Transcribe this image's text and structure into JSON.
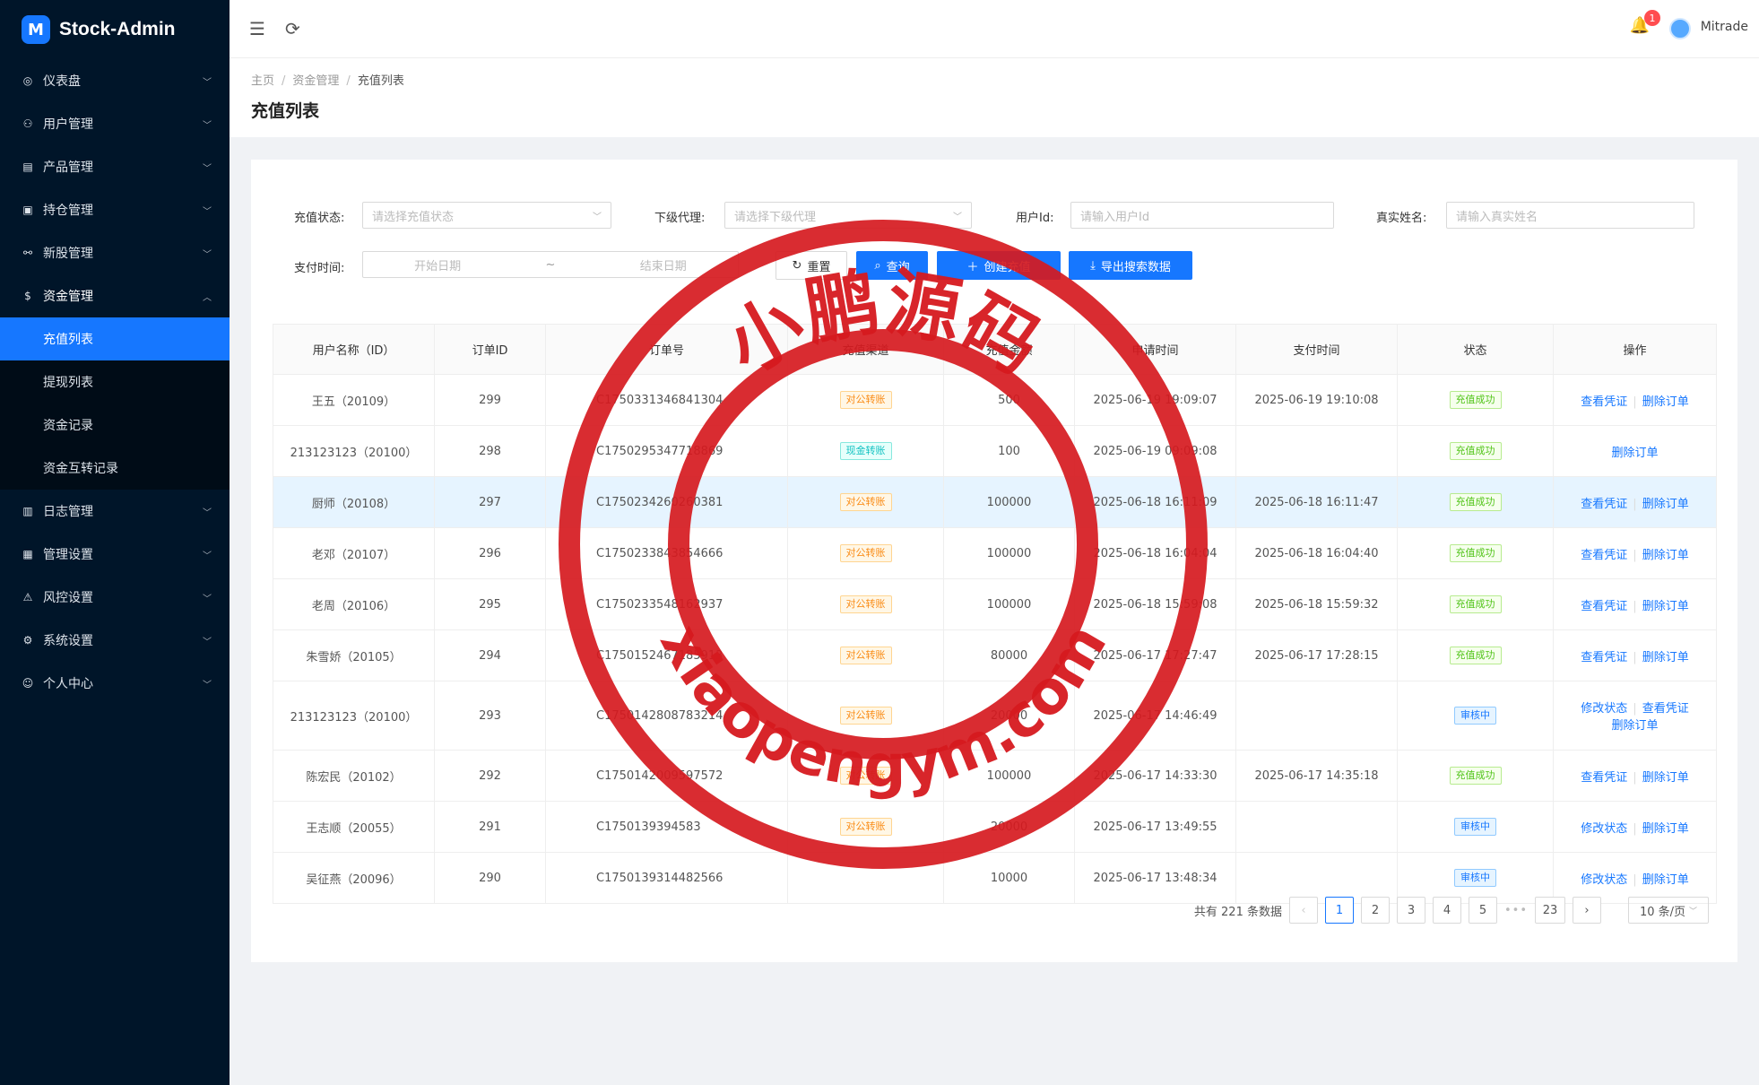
{
  "app": {
    "title": "Stock-Admin",
    "logo_glyph": "M"
  },
  "sidebar": {
    "items": [
      {
        "label": "仪表盘",
        "icon": "dashboard-icon"
      },
      {
        "label": "用户管理",
        "icon": "users-icon"
      },
      {
        "label": "产品管理",
        "icon": "chart-icon"
      },
      {
        "label": "持仓管理",
        "icon": "position-icon"
      },
      {
        "label": "新股管理",
        "icon": "ipo-icon"
      },
      {
        "label": "资金管理",
        "icon": "dollar-icon"
      },
      {
        "label": "日志管理",
        "icon": "log-icon"
      },
      {
        "label": "管理设置",
        "icon": "admin-icon"
      },
      {
        "label": "风控设置",
        "icon": "warning-icon"
      },
      {
        "label": "系统设置",
        "icon": "gear-icon"
      },
      {
        "label": "个人中心",
        "icon": "user-icon"
      }
    ],
    "submenu": [
      "充值列表",
      "提现列表",
      "资金记录",
      "资金互转记录"
    ]
  },
  "header": {
    "notification_count": "1",
    "username": "Mitrade"
  },
  "breadcrumb": {
    "home": "主页",
    "section": "资金管理",
    "current": "充值列表"
  },
  "page": {
    "title": "充值列表"
  },
  "filters": {
    "status_label": "充值状态:",
    "status_placeholder": "请选择充值状态",
    "agent_label": "下级代理:",
    "agent_placeholder": "请选择下级代理",
    "userid_label": "用户Id:",
    "userid_placeholder": "请输入用户Id",
    "realname_label": "真实姓名:",
    "realname_placeholder": "请输入真实姓名",
    "paytime_label": "支付时间:",
    "start_placeholder": "开始日期",
    "range_sep": "~",
    "end_placeholder": "结束日期",
    "reset_label": "重置",
    "query_label": "查询",
    "create_label": "创建充值",
    "export_label": "导出搜索数据"
  },
  "table": {
    "columns": [
      "用户名称（ID）",
      "订单ID",
      "订单号",
      "充值渠道",
      "充值金额",
      "申请时间",
      "支付时间",
      "状态",
      "操作"
    ],
    "rows": [
      {
        "user": "王五（20109）",
        "id": "299",
        "order": "C1750331346841304",
        "channel": "对公转账",
        "ch": "orange",
        "amount": "500",
        "apply": "2025-06-19 19:09:07",
        "pay": "2025-06-19 19:10:08",
        "status": "充值成功",
        "st": "green",
        "ops": [
          "查看凭证",
          "删除订单"
        ]
      },
      {
        "user": "213123123（20100）",
        "id": "298",
        "order": "C1750295347718869",
        "channel": "现金转账",
        "ch": "cyan",
        "amount": "100",
        "apply": "2025-06-19 09:09:08",
        "pay": "",
        "status": "充值成功",
        "st": "green",
        "ops": [
          "删除订单"
        ]
      },
      {
        "user": "厨师（20108）",
        "id": "297",
        "order": "C1750234260260381",
        "channel": "对公转账",
        "ch": "orange",
        "amount": "100000",
        "apply": "2025-06-18 16:11:09",
        "pay": "2025-06-18 16:11:47",
        "status": "充值成功",
        "st": "green",
        "ops": [
          "查看凭证",
          "删除订单"
        ]
      },
      {
        "user": "老邓（20107）",
        "id": "296",
        "order": "C1750233843854666",
        "channel": "对公转账",
        "ch": "orange",
        "amount": "100000",
        "apply": "2025-06-18 16:04:04",
        "pay": "2025-06-18 16:04:40",
        "status": "充值成功",
        "st": "green",
        "ops": [
          "查看凭证",
          "删除订单"
        ]
      },
      {
        "user": "老周（20106）",
        "id": "295",
        "order": "C1750233548162937",
        "channel": "对公转账",
        "ch": "orange",
        "amount": "100000",
        "apply": "2025-06-18 15:59:08",
        "pay": "2025-06-18 15:59:32",
        "status": "充值成功",
        "st": "green",
        "ops": [
          "查看凭证",
          "删除订单"
        ]
      },
      {
        "user": "朱雪娇（20105）",
        "id": "294",
        "order": "C1750152467185913",
        "channel": "对公转账",
        "ch": "orange",
        "amount": "80000",
        "apply": "2025-06-17 17:27:47",
        "pay": "2025-06-17 17:28:15",
        "status": "充值成功",
        "st": "green",
        "ops": [
          "查看凭证",
          "删除订单"
        ]
      },
      {
        "user": "213123123（20100）",
        "id": "293",
        "order": "C1750142808783214",
        "channel": "对公转账",
        "ch": "orange",
        "amount": "20000",
        "apply": "2025-06-17 14:46:49",
        "pay": "",
        "status": "审核中",
        "st": "blue",
        "ops": [
          "修改状态",
          "查看凭证",
          "删除订单"
        ]
      },
      {
        "user": "陈宏民（20102）",
        "id": "292",
        "order": "C1750142009597572",
        "channel": "对公转账",
        "ch": "orange",
        "amount": "100000",
        "apply": "2025-06-17 14:33:30",
        "pay": "2025-06-17 14:35:18",
        "status": "充值成功",
        "st": "green",
        "ops": [
          "查看凭证",
          "删除订单"
        ]
      },
      {
        "user": "王志顺（20055）",
        "id": "291",
        "order": "C1750139394583",
        "channel": "对公转账",
        "ch": "orange",
        "amount": "20000",
        "apply": "2025-06-17 13:49:55",
        "pay": "",
        "status": "审核中",
        "st": "blue",
        "ops": [
          "修改状态",
          "删除订单"
        ]
      },
      {
        "user": "吴征燕（20096）",
        "id": "290",
        "order": "C1750139314482566",
        "channel": "",
        "ch": "",
        "amount": "10000",
        "apply": "2025-06-17 13:48:34",
        "pay": "",
        "status": "审核中",
        "st": "blue",
        "ops": [
          "修改状态",
          "删除订单"
        ]
      }
    ]
  },
  "pagination": {
    "total_text": "共有 221 条数据",
    "pages": [
      "1",
      "2",
      "3",
      "4",
      "5"
    ],
    "last_page": "23",
    "ellipsis": "•••",
    "page_size": "10 条/页"
  },
  "watermark": {
    "top_text": "小鹏源码",
    "bottom_text": "xiaopengym.com",
    "color": "#d61a1f"
  }
}
